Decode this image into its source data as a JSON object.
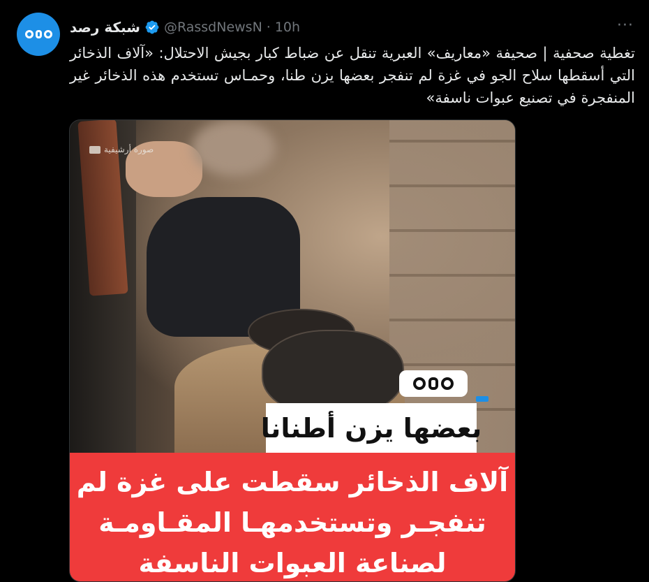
{
  "account": {
    "name": "شبكة رصد",
    "handle": "@RassdNewsN",
    "separator": "·",
    "time": "10h",
    "verified": true
  },
  "tweet": {
    "text": "تغطية صحفية | صحيفة «معاريف» العبرية تنقل عن ضباط كبار بجيش الاحتلال: «آلاف الذخائر التي أسقطها سلاح الجو في غزة لم تنفجر بعضها يزن طنا، وحمـاس تستخدم هذه الذخائر غير المنفجرة في تصنيع عبوات ناسفة»"
  },
  "more_label": "···",
  "media": {
    "archive_label": "صورة أرشيفية",
    "headline": "بعضها يزن أطنانا",
    "panel_lines": [
      "آلاف الذخائر سقطت على غزة لم",
      "تنفجـر وتستخدمهـا المقـاومـة",
      "لصناعة العبوات الناسفة"
    ]
  },
  "colors": {
    "accent": "#1d8fe6",
    "panel_red": "#ef3b3b",
    "muted": "#71767b",
    "text": "#e7e9ea"
  }
}
